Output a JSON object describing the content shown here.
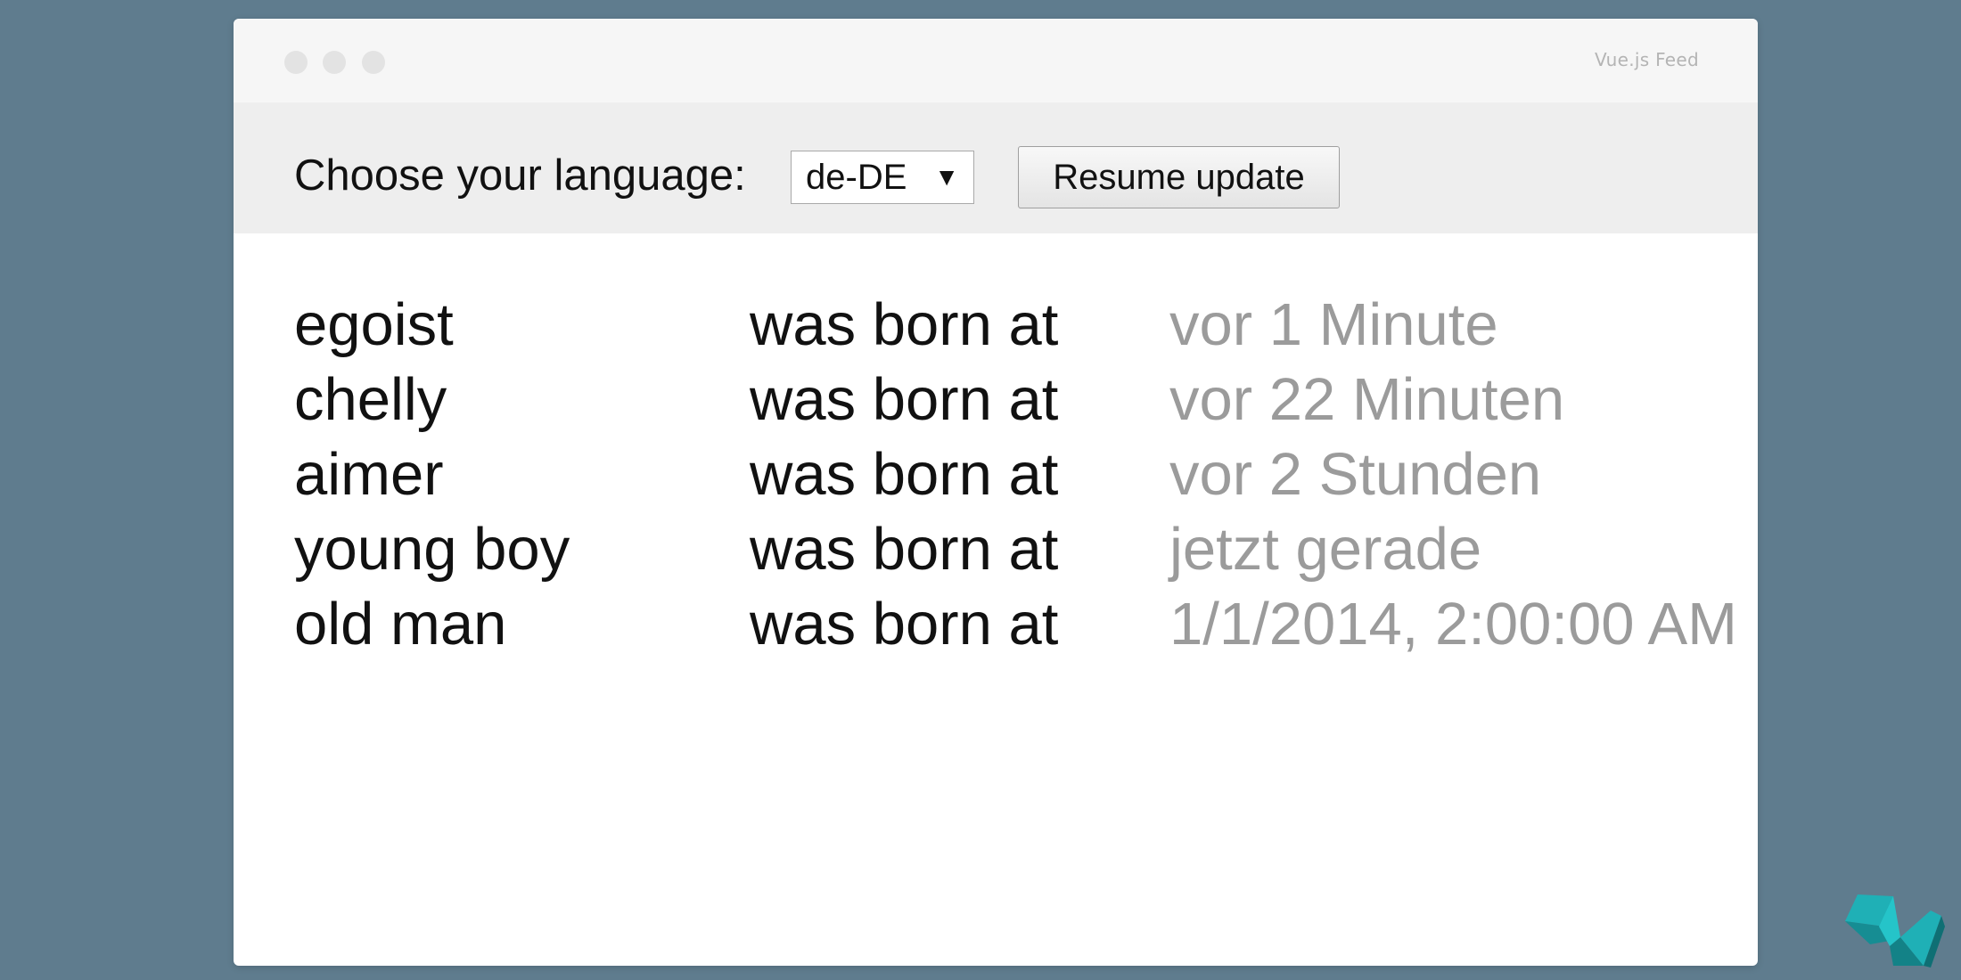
{
  "window": {
    "title": "Vue.js Feed"
  },
  "toolbar": {
    "language_label": "Choose your language:",
    "language_select": {
      "selected": "de-DE"
    },
    "resume_button_label": "Resume update"
  },
  "feed": {
    "connector": "was born at",
    "items": [
      {
        "name": "egoist",
        "time": "vor 1 Minute"
      },
      {
        "name": "chelly",
        "time": "vor 22 Minuten"
      },
      {
        "name": "aimer",
        "time": "vor 2 Stunden"
      },
      {
        "name": "young boy",
        "time": "jetzt gerade"
      },
      {
        "name": "old man",
        "time": "1/1/2014, 2:00:00 AM"
      }
    ]
  },
  "icons": {
    "dropdown": "chevron-down-icon",
    "logo": "brand-logo-icon"
  },
  "colors": {
    "background": "#5f7c8e",
    "time_text": "#9b9b9b",
    "logo": "#1fb0b6"
  }
}
